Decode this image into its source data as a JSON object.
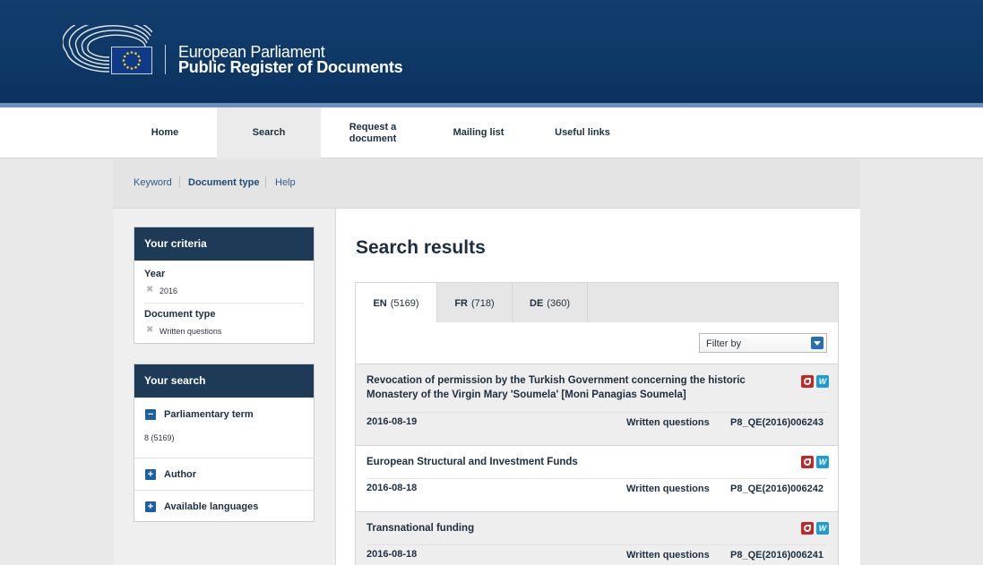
{
  "header": {
    "brand_line1": "European Parliament",
    "brand_line2": "Public Register of Documents",
    "colors": {
      "header_bg": "#0e3866",
      "accent_band": "#6d8fbe"
    }
  },
  "mainnav": {
    "items": [
      {
        "label": "Home"
      },
      {
        "label": "Search"
      },
      {
        "label": "Request a document"
      },
      {
        "label": "Mailing list"
      },
      {
        "label": "Useful links"
      }
    ],
    "active": "Search"
  },
  "subnav": {
    "items": [
      {
        "label": "Keyword"
      },
      {
        "label": "Document type"
      },
      {
        "label": "Help"
      }
    ],
    "active": "Document type"
  },
  "criteria": {
    "title": "Your criteria",
    "year_label": "Year",
    "year_value": "2016",
    "doctype_label": "Document type",
    "doctype_value": "Written questions",
    "remove_icon": "✖"
  },
  "your_search": {
    "title": "Your search",
    "facets": [
      {
        "label": "Parliamentary term",
        "expanded": true,
        "value": "8 (5169)",
        "icon": "−"
      },
      {
        "label": "Author",
        "expanded": false,
        "icon": "+"
      },
      {
        "label": "Available languages",
        "expanded": false,
        "icon": "+"
      }
    ]
  },
  "results": {
    "title": "Search results",
    "tabs": [
      {
        "lang": "EN",
        "count": "(5169)"
      },
      {
        "lang": "FR",
        "count": "(718)"
      },
      {
        "lang": "DE",
        "count": "(360)"
      }
    ],
    "active_tab": "EN",
    "filter_placeholder": "Filter by",
    "items": [
      {
        "title": "Revocation of permission by the Turkish Government concerning the historic Monastery of the Virgin Mary 'Soumela' [Moni Panagias Soumela]",
        "date": "2016-08-19",
        "type": "Written questions",
        "ref": "P8_QE(2016)006243"
      },
      {
        "title": "European Structural and Investment Funds",
        "date": "2016-08-18",
        "type": "Written questions",
        "ref": "P8_QE(2016)006242"
      },
      {
        "title": "Transnational funding",
        "date": "2016-08-18",
        "type": "Written questions",
        "ref": "P8_QE(2016)006241"
      }
    ],
    "word_icon_letter": "W"
  }
}
